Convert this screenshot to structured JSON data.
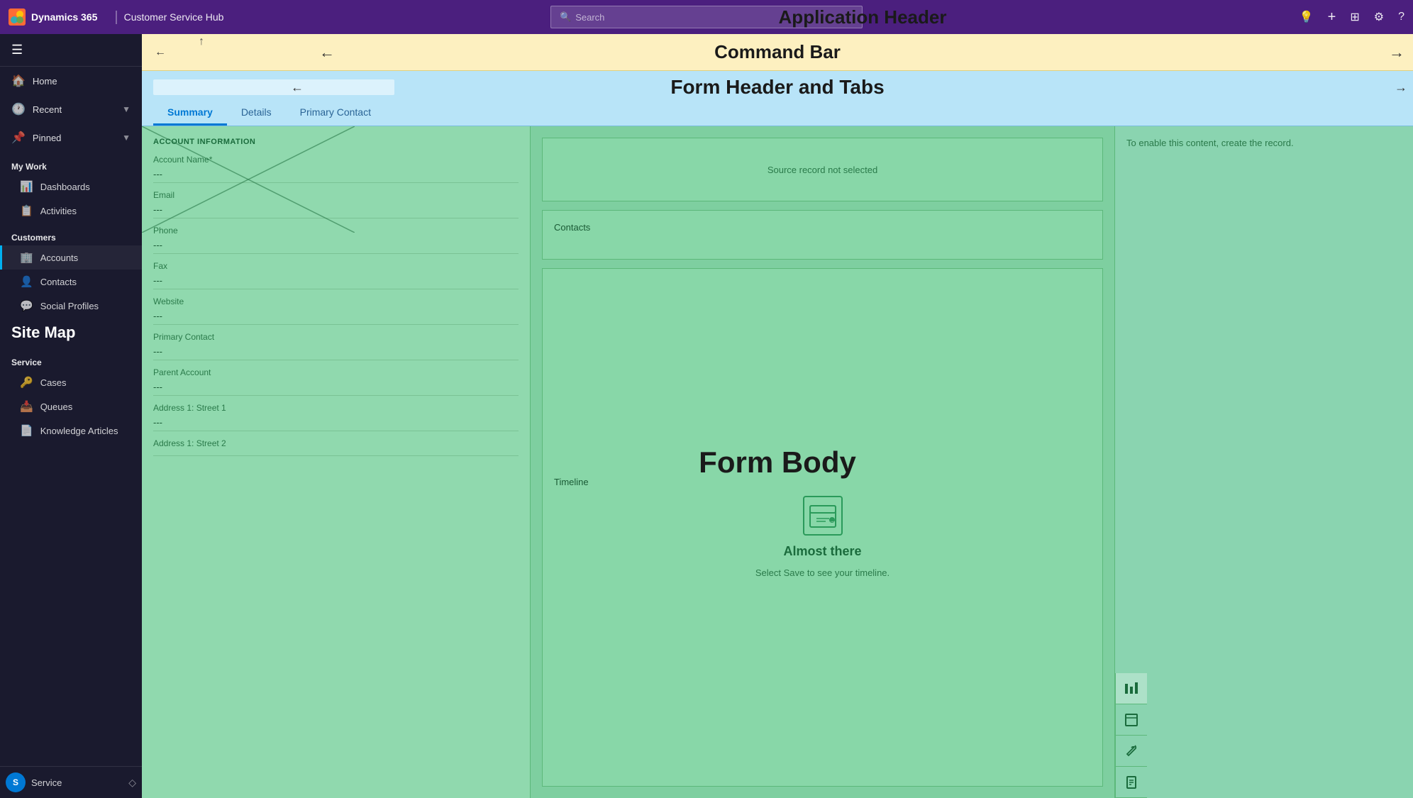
{
  "appHeader": {
    "logo": "D365",
    "appName": "Dynamics 365",
    "separator": "|",
    "moduleName": "Customer Service Hub",
    "searchPlaceholder": "Search",
    "centerLabel": "Application Header",
    "icons": {
      "light": "💡",
      "plus": "+",
      "filter": "⊞",
      "settings": "⚙",
      "help": "?"
    }
  },
  "commandBar": {
    "label": "Command Bar",
    "backIcon": "←",
    "arrowLeft": "←",
    "arrowRight": "→"
  },
  "formHeader": {
    "label": "Form Header and Tabs",
    "arrowLeft": "←",
    "arrowRight": "→",
    "tabs": [
      {
        "id": "summary",
        "label": "Summary",
        "active": true
      },
      {
        "id": "details",
        "label": "Details",
        "active": false
      },
      {
        "id": "primary-contact",
        "label": "Primary Contact",
        "active": false
      }
    ]
  },
  "formBody": {
    "label": "Form Body",
    "leftColumn": {
      "sectionTitle": "ACCOUNT INFORMATION",
      "fields": [
        {
          "label": "Account Name*",
          "value": "---"
        },
        {
          "label": "Email",
          "value": "---"
        },
        {
          "label": "Phone",
          "value": "---"
        },
        {
          "label": "Fax",
          "value": "---"
        },
        {
          "label": "Website",
          "value": "---"
        },
        {
          "label": "Primary Contact",
          "value": "---"
        },
        {
          "label": "Parent Account",
          "value": "---"
        },
        {
          "label": "Address 1: Street 1",
          "value": "---"
        },
        {
          "label": "Address 1: Street 2",
          "value": ""
        }
      ]
    },
    "middleColumn": {
      "sourceRecord": {
        "text": "Source record not selected"
      },
      "contacts": {
        "label": "Contacts"
      },
      "timeline": {
        "label": "Timeline",
        "almostThere": "Almost there",
        "saveHint": "Select Save to see your timeline."
      }
    },
    "rightColumn": {
      "enableText": "To enable this content, create the record.",
      "icons": [
        "📊",
        "□",
        "🔧",
        "📋"
      ]
    }
  },
  "sidebar": {
    "topNav": [
      {
        "id": "home",
        "label": "Home",
        "icon": "🏠"
      },
      {
        "id": "recent",
        "label": "Recent",
        "icon": "🕐",
        "expandable": true
      },
      {
        "id": "pinned",
        "label": "Pinned",
        "icon": "📌",
        "expandable": true
      }
    ],
    "sections": [
      {
        "label": "My Work",
        "items": [
          {
            "id": "dashboards",
            "label": "Dashboards",
            "icon": "📊"
          },
          {
            "id": "activities",
            "label": "Activities",
            "icon": "📋"
          }
        ]
      },
      {
        "label": "Customers",
        "items": [
          {
            "id": "accounts",
            "label": "Accounts",
            "icon": "🏢",
            "active": true
          },
          {
            "id": "contacts",
            "label": "Contacts",
            "icon": "👤"
          },
          {
            "id": "social-profiles",
            "label": "Social Profiles",
            "icon": "💬"
          }
        ]
      },
      {
        "label": "Service",
        "items": [
          {
            "id": "cases",
            "label": "Cases",
            "icon": "🔑"
          },
          {
            "id": "queues",
            "label": "Queues",
            "icon": "📥"
          },
          {
            "id": "knowledge-articles",
            "label": "Knowledge Articles",
            "icon": "📄"
          }
        ]
      }
    ],
    "siteMapLabel": "Site Map",
    "footer": {
      "avatar": "S",
      "label": "Service",
      "expandIcon": "◇"
    }
  }
}
